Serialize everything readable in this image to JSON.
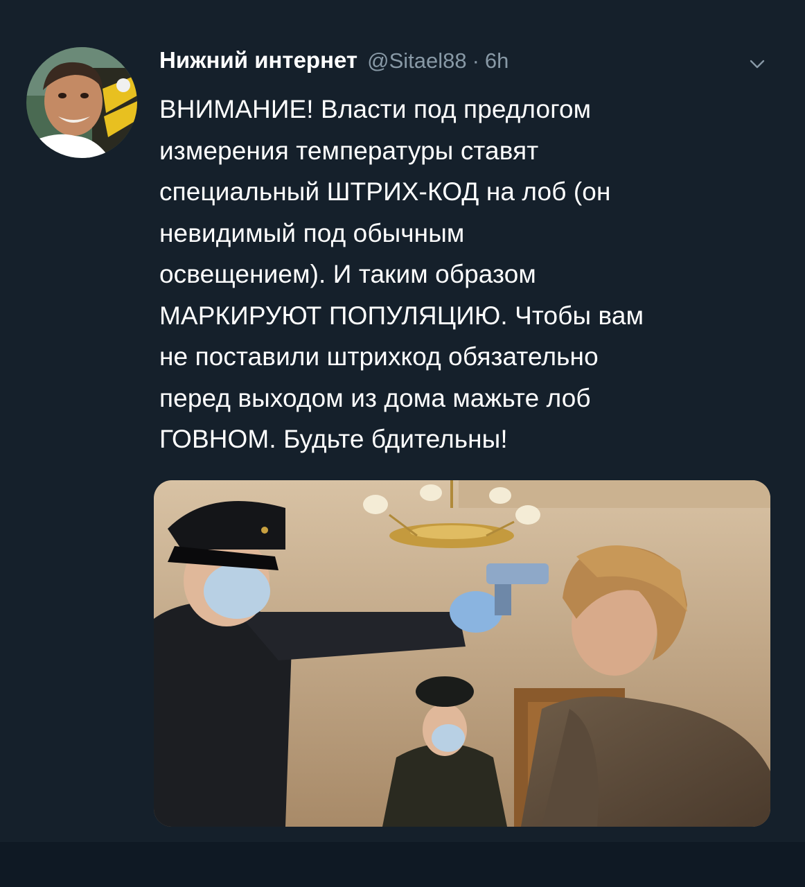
{
  "tweet": {
    "author": {
      "display_name": "Нижний интернет",
      "handle": "@Sitael88",
      "separator": "·",
      "time": "6h"
    },
    "menu_icon": "chevron-down-icon",
    "text_lines": [
      "ВНИМАНИЕ! Власти под предлогом",
      "измерения температуры ставят",
      "специальный ШТРИХ-КОД на лоб (он",
      "невидимый под обычным",
      "освещением). И таким образом",
      "МАРКИРУЮТ ПОПУЛЯЦИЮ. Чтобы вам",
      "не поставили штрихкод обязательно",
      "перед выходом из дома мажьте лоб",
      "ГОВНОМ. Будьте бдительны!"
    ]
  },
  "colors": {
    "background": "#15202b",
    "text": "#ffffff",
    "secondary_text": "#8899a6"
  }
}
